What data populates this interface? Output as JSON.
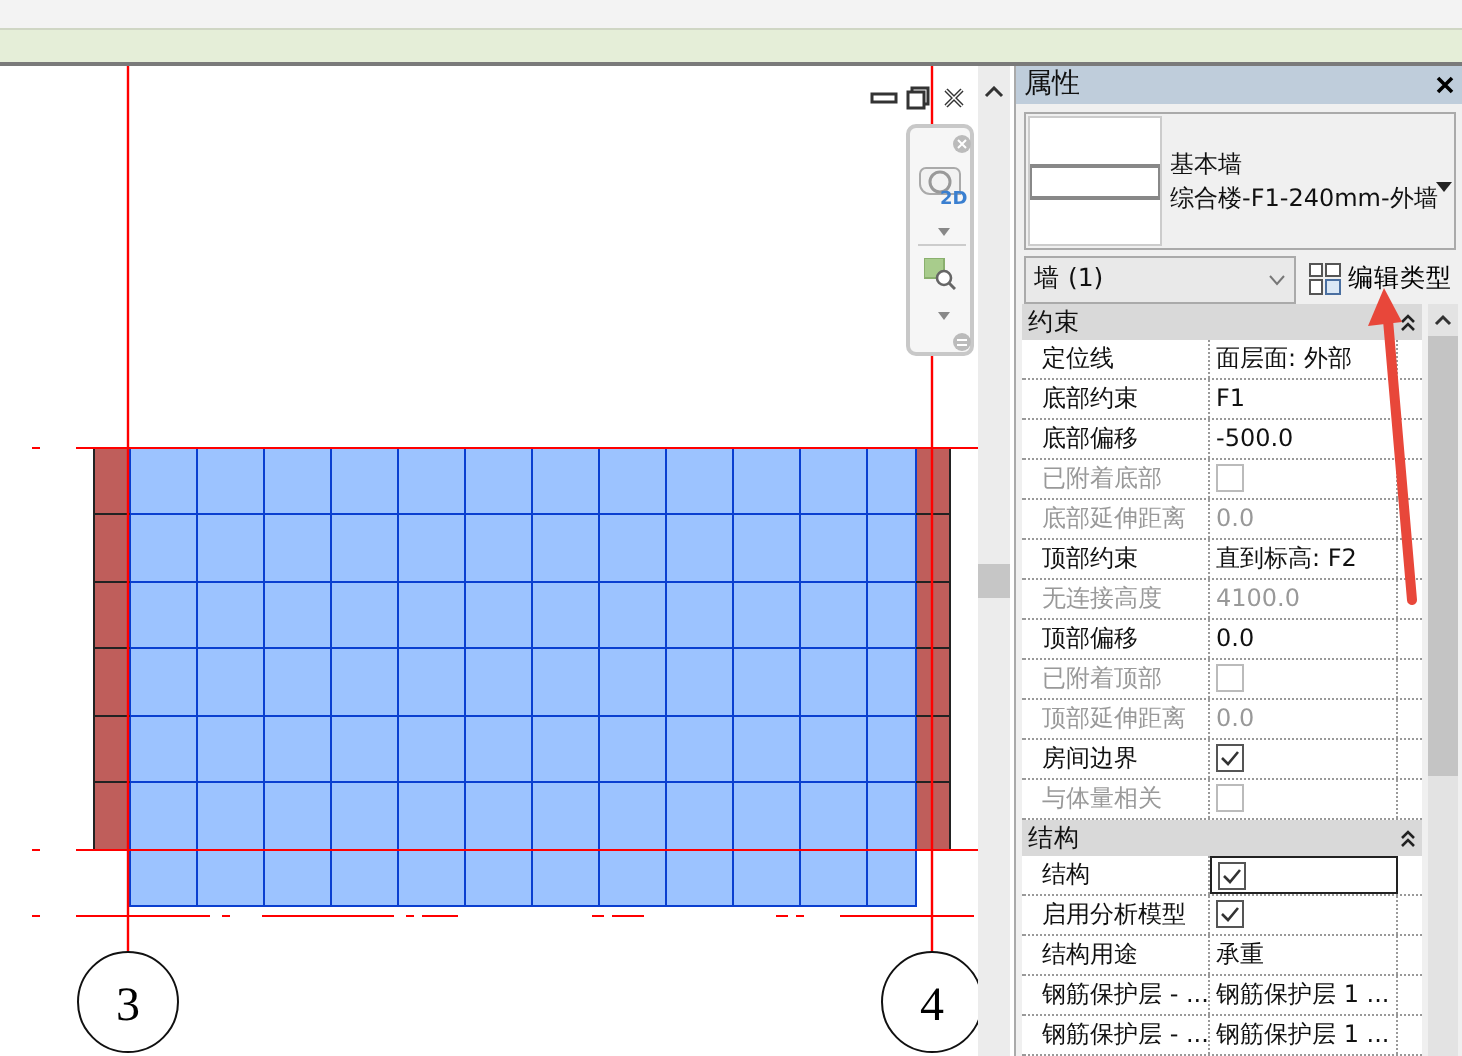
{
  "view": {
    "nav_label": "2D",
    "grid_labels": [
      "3",
      "4"
    ]
  },
  "properties": {
    "title": "属性",
    "type_family": "基本墙",
    "type_name": "综合楼-F1-240mm-外墙",
    "selector": "墙 (1)",
    "edit_type_button": "编辑类型",
    "groups": [
      {
        "title": "约束",
        "expanded": true,
        "rows": [
          {
            "label": "定位线",
            "kind": "text",
            "value": "面层面: 外部",
            "disabled": false,
            "selected": false
          },
          {
            "label": "底部约束",
            "kind": "text",
            "value": "F1",
            "disabled": false,
            "selected": false
          },
          {
            "label": "底部偏移",
            "kind": "text",
            "value": "-500.0",
            "disabled": false,
            "selected": false
          },
          {
            "label": "已附着底部",
            "kind": "checkbox",
            "checked": false,
            "disabled": true,
            "selected": false
          },
          {
            "label": "底部延伸距离",
            "kind": "text",
            "value": "0.0",
            "disabled": true,
            "selected": false
          },
          {
            "label": "顶部约束",
            "kind": "text",
            "value": "直到标高: F2",
            "disabled": false,
            "selected": false
          },
          {
            "label": "无连接高度",
            "kind": "text",
            "value": "4100.0",
            "disabled": true,
            "selected": false
          },
          {
            "label": "顶部偏移",
            "kind": "text",
            "value": "0.0",
            "disabled": false,
            "selected": false
          },
          {
            "label": "已附着顶部",
            "kind": "checkbox",
            "checked": false,
            "disabled": true,
            "selected": false
          },
          {
            "label": "顶部延伸距离",
            "kind": "text",
            "value": "0.0",
            "disabled": true,
            "selected": false
          },
          {
            "label": "房间边界",
            "kind": "checkbox",
            "checked": true,
            "disabled": false,
            "selected": false
          },
          {
            "label": "与体量相关",
            "kind": "checkbox",
            "checked": false,
            "disabled": true,
            "selected": false
          }
        ]
      },
      {
        "title": "结构",
        "expanded": true,
        "rows": [
          {
            "label": "结构",
            "kind": "checkbox",
            "checked": true,
            "disabled": false,
            "selected": true
          },
          {
            "label": "启用分析模型",
            "kind": "checkbox",
            "checked": true,
            "disabled": false,
            "selected": false
          },
          {
            "label": "结构用途",
            "kind": "text",
            "value": "承重",
            "disabled": false,
            "selected": false
          },
          {
            "label": "钢筋保护层 - ...",
            "kind": "text",
            "value": "钢筋保护层 1 ...",
            "disabled": false,
            "selected": false
          },
          {
            "label": "钢筋保护层 - ...",
            "kind": "text",
            "value": "钢筋保护层 1 ...",
            "disabled": false,
            "selected": false
          }
        ]
      }
    ]
  }
}
